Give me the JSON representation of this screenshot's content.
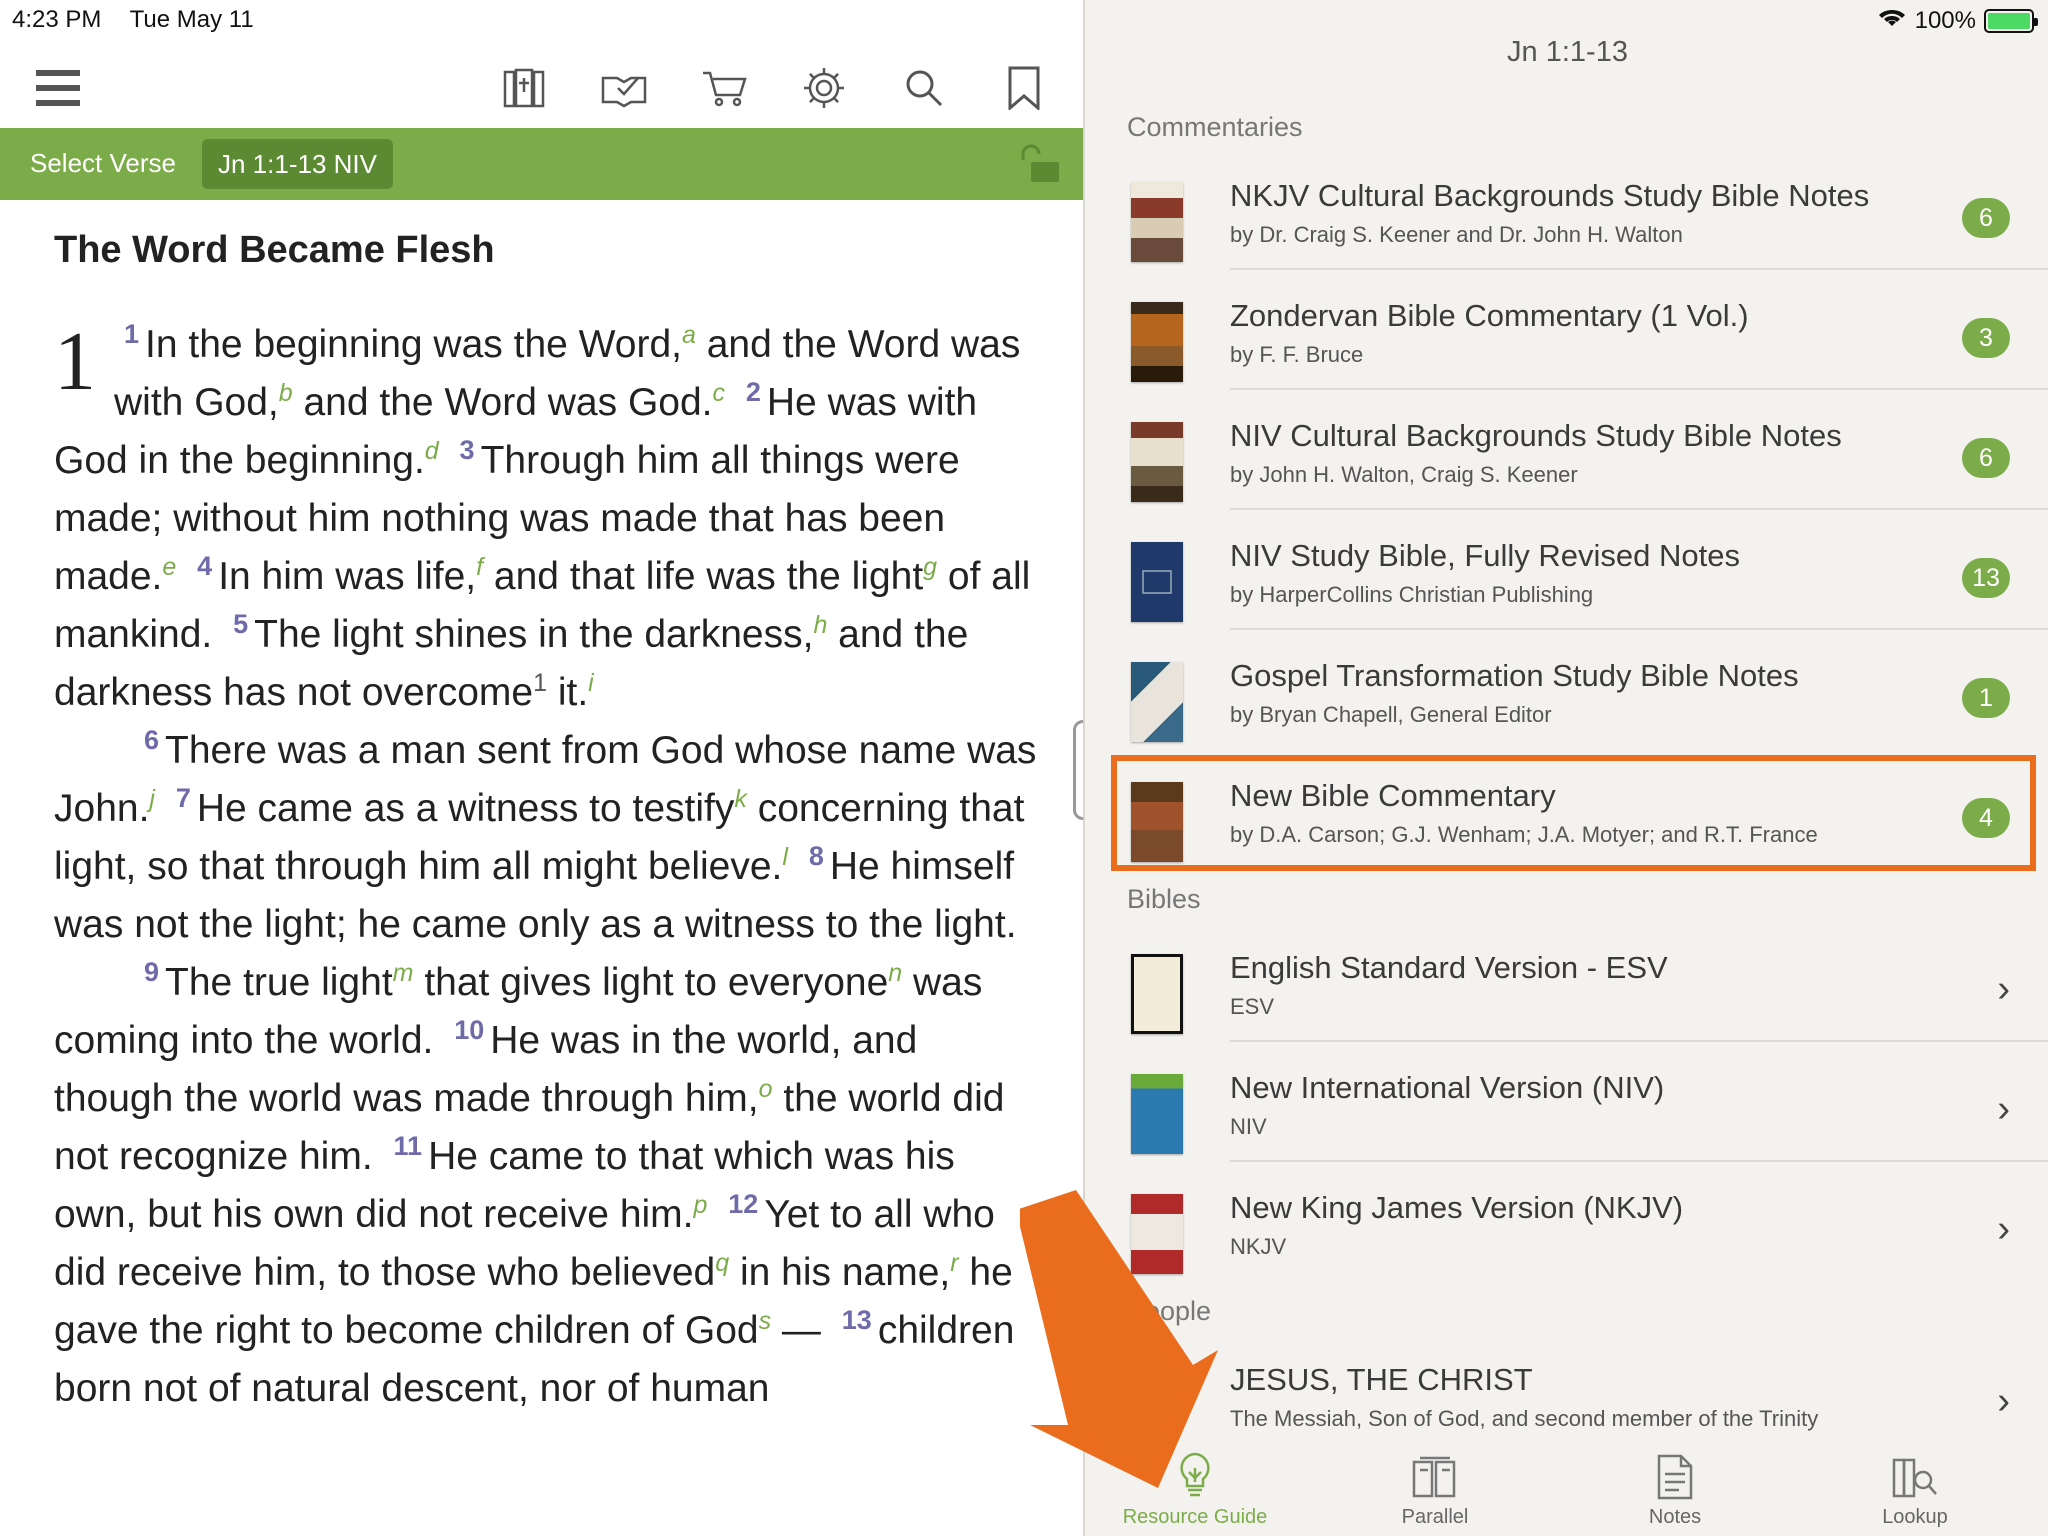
{
  "status": {
    "time": "4:23 PM",
    "date": "Tue May 11",
    "battery": "100%"
  },
  "toolbar": {
    "icons": [
      "menu-icon",
      "library-icon",
      "reading-plan-icon",
      "store-icon",
      "settings-icon",
      "search-icon",
      "bookmark-icon"
    ]
  },
  "verse_bar": {
    "select_label": "Select Verse",
    "reference": "Jn 1:1-13 NIV"
  },
  "scripture": {
    "heading": "The Word Became Flesh",
    "chapter": "1",
    "v1": "1",
    "t1a": "In the beginning was the Word,",
    "f_a": "a",
    "t1b": " and the Word was with God,",
    "f_b": "b",
    "t1c": " and the Word was God.",
    "f_c": "c",
    "v2": "2",
    "t2": "He was with God in the beginning.",
    "f_d": "d",
    "v3": "3",
    "t3": "Through him all things were made; without him nothing was made that has been made.",
    "f_e": "e",
    "v4": "4",
    "t4a": "In him was life,",
    "f_f": "f",
    "t4b": " and that life was the light",
    "f_g": "g",
    "t4c": " of all mankind.",
    "v5": "5",
    "t5a": "The light shines in the darkness,",
    "f_h": "h",
    "t5b": " and the darkness has not overcome",
    "f_1": "1",
    "t5c": " it.",
    "f_i": "i",
    "v6": "6",
    "t6": "There was a man sent from God whose name was John.",
    "f_j": "j",
    "v7": "7",
    "t7a": "He came as a witness to testify",
    "f_k": "k",
    "t7b": " concerning that light, so that through him all might believe.",
    "f_l": "l",
    "v8": "8",
    "t8": "He himself was not the light; he came only as a witness to the light.",
    "v9": "9",
    "t9a": "The true light",
    "f_m": "m",
    "t9b": " that gives light to everyone",
    "f_n": "n",
    "t9c": " was coming into the world.",
    "v10": "10",
    "t10a": "He was in the world, and though the world was made through him,",
    "f_o": "o",
    "t10b": " the world did not recognize him.",
    "v11": "11",
    "t11": "He came to that which was his own, but his own did not receive him.",
    "f_p": "p",
    "v12": "12",
    "t12a": "Yet to all who did receive him, to those who believed",
    "f_q": "q",
    "t12b": " in his name,",
    "f_r": "r",
    "t12c": " he gave the right to become children of God",
    "f_s": "s",
    "t12d": " —",
    "v13": "13",
    "t13": "children born not of natural descent, nor of human"
  },
  "right_pane": {
    "title": "Jn 1:1-13",
    "sections": {
      "commentaries": "Commentaries",
      "bibles": "Bibles",
      "people": "People"
    },
    "commentaries": [
      {
        "title": "NKJV Cultural Backgrounds Study Bible Notes",
        "sub": "by Dr. Craig S. Keener and Dr. John H. Walton",
        "count": "6"
      },
      {
        "title": "Zondervan Bible Commentary (1 Vol.)",
        "sub": "by F. F. Bruce",
        "count": "3"
      },
      {
        "title": "NIV Cultural Backgrounds Study Bible Notes",
        "sub": "by John H. Walton, Craig S. Keener",
        "count": "6"
      },
      {
        "title": "NIV Study Bible, Fully Revised Notes",
        "sub": "by HarperCollins Christian Publishing",
        "count": "13"
      },
      {
        "title": "Gospel Transformation Study Bible Notes",
        "sub": "by Bryan Chapell, General Editor",
        "count": "1"
      },
      {
        "title": "New Bible Commentary",
        "sub": "by D.A. Carson; G.J. Wenham; J.A. Motyer; and R.T. France",
        "count": "4"
      }
    ],
    "bibles": [
      {
        "title": "English Standard Version - ESV",
        "sub": "ESV"
      },
      {
        "title": "New International Version (NIV)",
        "sub": "NIV"
      },
      {
        "title": "New King James Version (NKJV)",
        "sub": "NKJV"
      }
    ],
    "people": [
      {
        "title": "JESUS, THE CHRIST",
        "sub": "The Messiah, Son of God, and second member of the Trinity"
      }
    ]
  },
  "tabs": [
    {
      "label": "Resource Guide",
      "icon": "lightbulb-icon",
      "active": true
    },
    {
      "label": "Parallel",
      "icon": "parallel-books-icon",
      "active": false
    },
    {
      "label": "Notes",
      "icon": "notes-icon",
      "active": false
    },
    {
      "label": "Lookup",
      "icon": "lookup-icon",
      "active": false
    }
  ],
  "colors": {
    "accent_green": "#7cac49",
    "highlight_orange": "#ea6c1d",
    "verse_number": "#6f6aa8"
  }
}
